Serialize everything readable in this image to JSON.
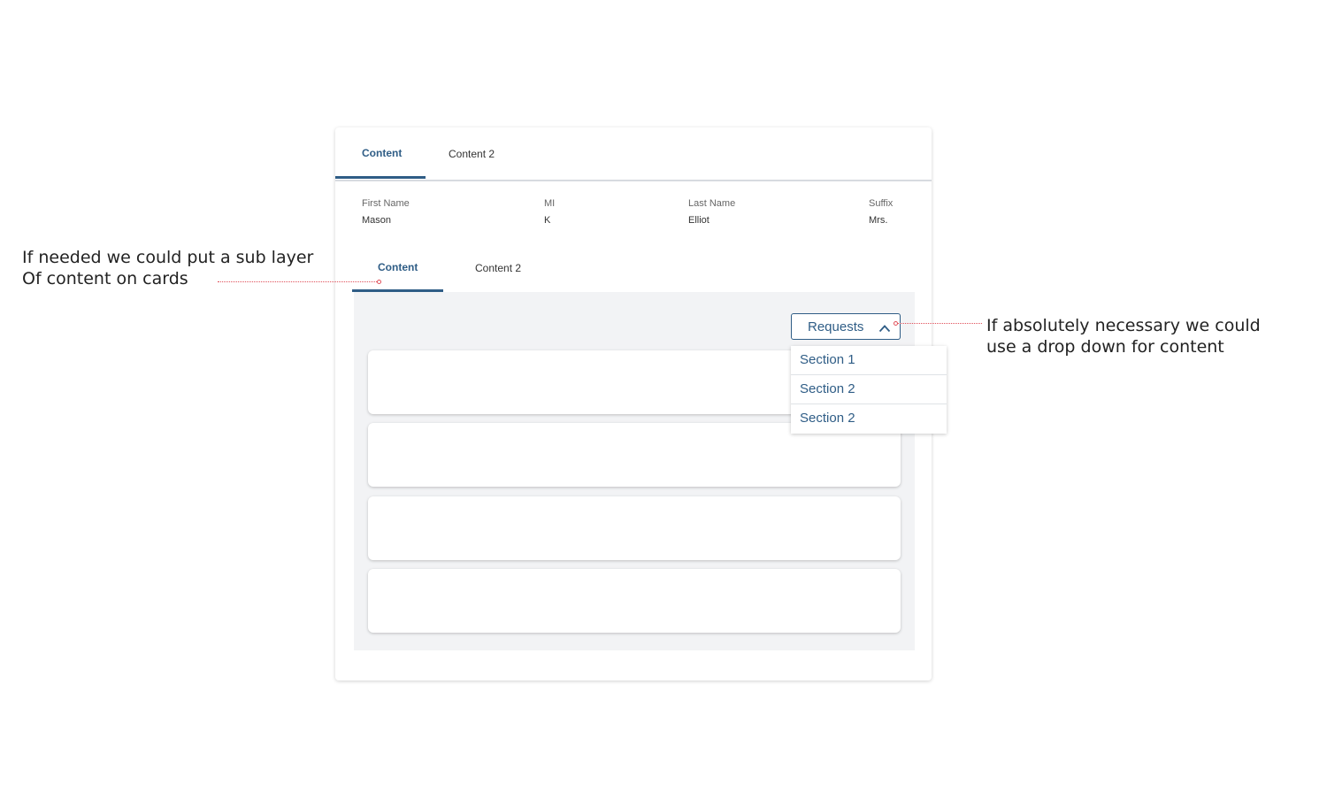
{
  "top_tabs": [
    {
      "label": "Content",
      "active": true
    },
    {
      "label": "Content 2",
      "active": false
    }
  ],
  "fields": [
    {
      "label": "First Name",
      "value": "Mason"
    },
    {
      "label": "MI",
      "value": "K"
    },
    {
      "label": "Last Name",
      "value": "Elliot"
    },
    {
      "label": "Suffix",
      "value": "Mrs."
    }
  ],
  "inner_tabs": [
    {
      "label": "Content",
      "active": true
    },
    {
      "label": "Content 2",
      "active": false
    }
  ],
  "dropdown": {
    "label": "Requests",
    "icon": "chevron-up-icon",
    "options": [
      "Section 1",
      "Section 2",
      "Section 2"
    ]
  },
  "annotations": {
    "left": [
      "If needed we could put a sub layer",
      "Of content on cards"
    ],
    "right": [
      "If absolutely necessary we could",
      "use a drop down for content"
    ]
  },
  "colors": {
    "accent": "#2f5d86",
    "leader": "#e0505a",
    "panel_bg": "#f2f3f5"
  }
}
